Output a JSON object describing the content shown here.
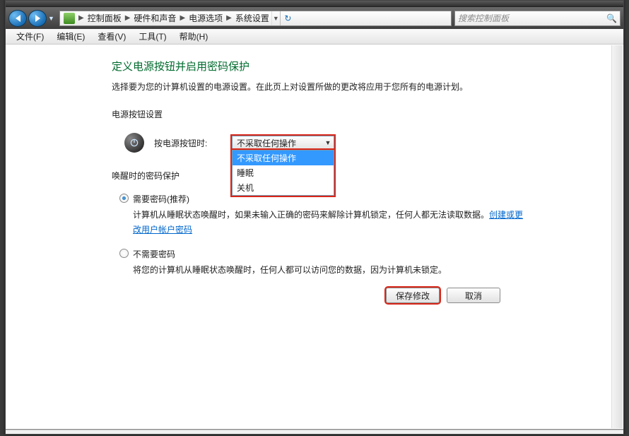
{
  "breadcrumb": {
    "items": [
      "控制面板",
      "硬件和声音",
      "电源选项",
      "系统设置"
    ]
  },
  "search": {
    "placeholder": "搜索控制面板"
  },
  "menu": {
    "file": "文件(F)",
    "edit": "编辑(E)",
    "view": "查看(V)",
    "tools": "工具(T)",
    "help": "帮助(H)"
  },
  "page": {
    "title": "定义电源按钮并启用密码保护",
    "desc": "选择要为您的计算机设置的电源设置。在此页上对设置所做的更改将应用于您所有的电源计划。"
  },
  "power_button": {
    "section_title": "电源按钮设置",
    "label": "按电源按钮时:",
    "selected": "不采取任何操作",
    "options": [
      "不采取任何操作",
      "睡眠",
      "关机"
    ]
  },
  "wake": {
    "section_title": "唤醒时的密码保护",
    "opt1_label": "需要密码(推荐)",
    "opt1_desc_a": "计算机从睡眠状态唤醒时，如果未输入正确的密码来解除计算机锁定，任何人都无法读取数据。",
    "opt1_link": "创建或更改用户帐户密码",
    "opt2_label": "不需要密码",
    "opt2_desc": "将您的计算机从睡眠状态唤醒时，任何人都可以访问您的数据，因为计算机未锁定。"
  },
  "buttons": {
    "save": "保存修改",
    "cancel": "取消"
  }
}
